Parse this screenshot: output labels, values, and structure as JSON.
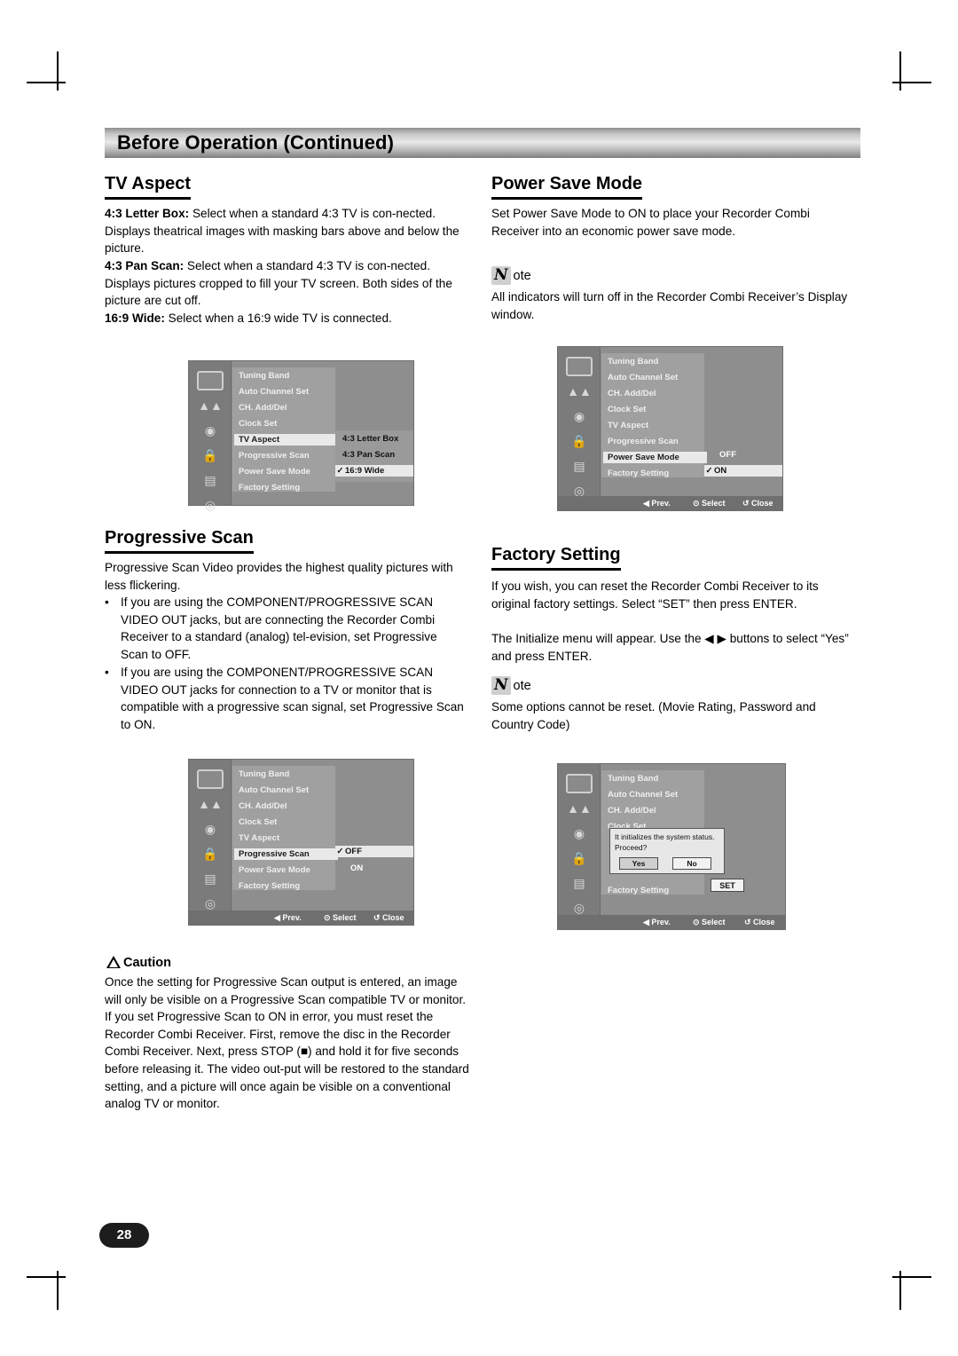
{
  "header": {
    "title": "Before Operation (Continued)"
  },
  "page_number": "28",
  "sections": {
    "tv_aspect": {
      "heading": "TV Aspect",
      "p1_label": "4:3 Letter Box:",
      "p1_text": " Select when a standard 4:3 TV is con-nected. Displays theatrical images with masking bars above and below the picture.",
      "p2_label": "4:3 Pan Scan:",
      "p2_text": " Select when a standard 4:3 TV is con-nected. Displays pictures cropped to fill your TV screen. Both sides of the picture are cut off.",
      "p3_label": "16:9 Wide:",
      "p3_text": " Select when a 16:9 wide TV is connected."
    },
    "progressive_scan": {
      "heading": "Progressive Scan",
      "intro": "Progressive Scan Video provides the highest quality pictures with less flickering.",
      "bullets": [
        "If you are using the COMPONENT/PROGRESSIVE SCAN VIDEO OUT jacks, but are connecting the Recorder Combi Receiver to a standard (analog) tel-evision, set Progressive Scan to OFF.",
        "If you are using the COMPONENT/PROGRESSIVE SCAN VIDEO OUT jacks for connection to a TV or monitor that is compatible with a progressive scan signal, set Progressive Scan to ON."
      ],
      "caution_label": "Caution",
      "caution_text": "Once the setting for Progressive Scan output is entered, an image will only be visible on a Progressive Scan compatible TV or monitor. If you set Progressive Scan to ON in error, you must reset the Recorder Combi Receiver. First, remove the disc in the Recorder Combi Receiver. Next, press STOP (■) and hold it for five seconds before releasing it. The video out-put will be restored to the standard setting, and a picture will once again be visible on a conventional analog TV or monitor."
    },
    "power_save": {
      "heading": "Power Save Mode",
      "text": "Set Power Save Mode to ON to place your Recorder Combi Receiver into an economic power save mode.",
      "note_label": "ote",
      "note_text": "All indicators will turn off in the Recorder Combi Receiver’s Display window."
    },
    "factory_setting": {
      "heading": "Factory Setting",
      "p1": "If you wish, you can reset the Recorder Combi Receiver to its original factory settings. Select “SET” then press ENTER.",
      "p2": "The Initialize menu will appear. Use the ◀ ▶ buttons to select “Yes” and press ENTER.",
      "note_label": "ote",
      "note_text": "Some options cannot be reset. (Movie Rating, Password and Country Code)"
    }
  },
  "osd": {
    "menu_items": [
      "Tuning Band",
      "Auto Channel Set",
      "CH. Add/Del",
      "Clock Set",
      "TV Aspect",
      "Progressive Scan",
      "Power Save Mode",
      "Factory Setting"
    ],
    "bar": {
      "prev": "◀ Prev.",
      "select": "⊙ Select",
      "close": "↺ Close"
    },
    "tv_aspect_options": [
      "4:3 Letter Box",
      "4:3 Pan Scan",
      "16:9 Wide"
    ],
    "tv_aspect_checked": "16:9 Wide",
    "power_save_options": [
      "OFF",
      "ON"
    ],
    "power_save_checked": "ON",
    "progressive_options": [
      "OFF",
      "ON"
    ],
    "progressive_checked": "OFF",
    "factory_dialog": {
      "line1": "It initializes the system status.",
      "line2": "Proceed?",
      "yes": "Yes",
      "no": "No",
      "set": "SET"
    }
  }
}
